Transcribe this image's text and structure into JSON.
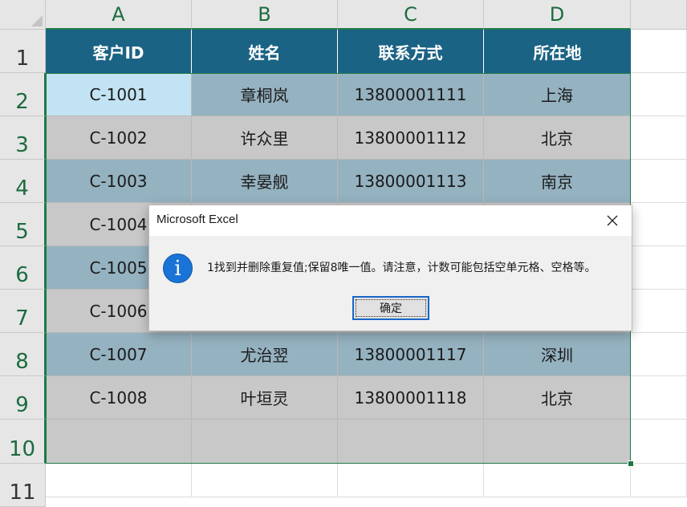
{
  "columns": [
    "A",
    "B",
    "C",
    "D"
  ],
  "rows": [
    "1",
    "2",
    "3",
    "4",
    "5",
    "6",
    "7",
    "8",
    "9",
    "10",
    "11"
  ],
  "table": {
    "headers": [
      "客户ID",
      "姓名",
      "联系方式",
      "所在地"
    ],
    "records": [
      [
        "C-1001",
        "章桐岚",
        "13800001111",
        "上海"
      ],
      [
        "C-1002",
        "许众里",
        "13800001112",
        "北京"
      ],
      [
        "C-1003",
        "幸晏舰",
        "13800001113",
        "南京"
      ],
      [
        "C-1004",
        "",
        "",
        ""
      ],
      [
        "C-1005",
        "",
        "",
        ""
      ],
      [
        "C-1006",
        "",
        "",
        ""
      ],
      [
        "C-1007",
        "尤治翌",
        "13800001117",
        "深圳"
      ],
      [
        "C-1008",
        "叶垣灵",
        "13800001118",
        "北京"
      ]
    ]
  },
  "dialog": {
    "title": "Microsoft Excel",
    "message": "1找到并删除重复值;保留8唯一值。请注意，计数可能包括空单元格、空格等。",
    "ok_label": "确定",
    "icon": "info-icon"
  },
  "colors": {
    "header_fill": "#1b6384",
    "band_blue": "#95b2c0",
    "band_gray": "#c8c8c8",
    "active_cell": "#c2e3f3",
    "selection_border": "#1d7a47"
  }
}
